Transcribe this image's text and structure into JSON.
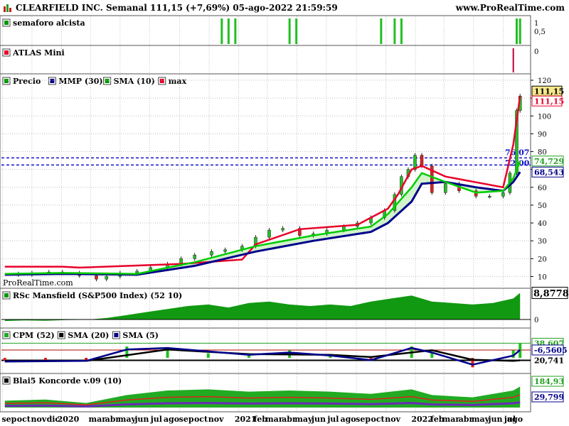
{
  "header": {
    "title": "CLEARFIELD INC. Semanal 111,15 (+7,69%) 05-ago-2022 21:59:59",
    "site": "www.ProRealTime.com"
  },
  "watermark": "ProRealTime.com",
  "colors": {
    "green": "#009900",
    "lightgreen": "#00cc00",
    "red": "#e8002a",
    "navy": "#00008b",
    "blue": "#1010cc",
    "grid": "#c0c0c0",
    "box": "#f6e88a"
  },
  "chart_data": [
    {
      "type": "bar",
      "name": "semaforo alcista",
      "title": "semaforo alcista",
      "ytick_labels": [
        "1",
        "0,5"
      ],
      "signal_dates": [
        "2020-11-27",
        "2020-12-11",
        "2020-12-25",
        "2021-04-16",
        "2021-04-30",
        "2021-10-22",
        "2021-11-19",
        "2021-12-03",
        "2022-07-29",
        "2022-08-05"
      ]
    },
    {
      "type": "bar",
      "name": "ATLAS Mini",
      "title": "ATLAS Mini",
      "ytick_labels": [
        "0"
      ],
      "signal_dates": [
        "2022-07-22"
      ]
    },
    {
      "type": "line",
      "title": "Precio",
      "legend": [
        "Precio",
        "MMP (30)",
        "SMA (10)",
        "max"
      ],
      "ylim": [
        5,
        122
      ],
      "ytick_labels": [
        "120",
        "110",
        "100",
        "90",
        "80",
        "70",
        "60",
        "50",
        "40",
        "30",
        "20",
        "10"
      ],
      "hlines": [
        76.5,
        72.5
      ],
      "annotations": [
        "76,07",
        "72,00"
      ],
      "last_values": {
        "price": "111,15",
        "max": "111,15",
        "sma10": "74,729",
        "mmp30": "68,543"
      },
      "x_labels": [
        "sep",
        "oct",
        "nov",
        "dic",
        "2020",
        "mar",
        "abr",
        "may",
        "jun",
        "jul",
        "ago",
        "sep",
        "oct",
        "nov",
        "2021",
        "feb",
        "mar",
        "abr",
        "may",
        "jun",
        "jul",
        "ago",
        "sep",
        "oct",
        "nov",
        "2022",
        "feb",
        "mar",
        "abr",
        "may",
        "jun",
        "jul",
        "ago"
      ],
      "series": [
        {
          "name": "Precio",
          "x": [
            "2019-09-06",
            "2019-10-04",
            "2019-11-01",
            "2019-12-06",
            "2020-01-03",
            "2020-02-07",
            "2020-03-13",
            "2020-04-03",
            "2020-05-01",
            "2020-06-05",
            "2020-07-03",
            "2020-08-07",
            "2020-09-04",
            "2020-10-02",
            "2020-11-06",
            "2020-12-04",
            "2021-01-08",
            "2021-02-05",
            "2021-03-05",
            "2021-04-02",
            "2021-05-07",
            "2021-06-04",
            "2021-07-02",
            "2021-08-06",
            "2021-09-03",
            "2021-10-01",
            "2021-10-29",
            "2021-11-19",
            "2021-12-03",
            "2021-12-17",
            "2021-12-31",
            "2022-01-14",
            "2022-02-04",
            "2022-03-04",
            "2022-04-01",
            "2022-05-06",
            "2022-06-03",
            "2022-07-01",
            "2022-07-15",
            "2022-07-29",
            "2022-08-05"
          ],
          "values": [
            11.5,
            11,
            12,
            12.5,
            12,
            10.5,
            8.5,
            10,
            12,
            13,
            15,
            17,
            20,
            22,
            24,
            25,
            27,
            32,
            36,
            37,
            33,
            34,
            36,
            38,
            40,
            43,
            47,
            56,
            66,
            70,
            78,
            72,
            57,
            62,
            58,
            55,
            55,
            57,
            68,
            103,
            111.15
          ]
        },
        {
          "name": "max",
          "x": [
            "2019-09-06",
            "2020-01-03",
            "2020-02-07",
            "2020-09-04",
            "2021-01-08",
            "2021-02-05",
            "2021-05-07",
            "2021-09-03",
            "2021-10-01",
            "2021-11-05",
            "2021-11-26",
            "2021-12-24",
            "2022-01-14",
            "2022-03-04",
            "2022-07-01",
            "2022-07-22",
            "2022-08-05"
          ],
          "values": [
            15.5,
            15.5,
            15,
            17,
            19.5,
            28,
            36.5,
            39,
            43,
            48,
            56,
            70,
            72,
            66,
            60,
            84,
            111.15
          ]
        },
        {
          "name": "SMA (10)",
          "x": [
            "2019-09-06",
            "2020-01-03",
            "2020-06-05",
            "2020-10-02",
            "2021-02-05",
            "2021-06-04",
            "2021-10-01",
            "2021-11-05",
            "2021-12-24",
            "2022-01-14",
            "2022-03-04",
            "2022-05-06",
            "2022-07-01",
            "2022-07-22",
            "2022-08-05"
          ],
          "values": [
            11.5,
            12,
            11.5,
            18,
            27,
            33,
            38,
            45,
            60,
            68,
            63,
            57,
            58,
            65,
            74.729
          ]
        },
        {
          "name": "MMP (30)",
          "x": [
            "2019-09-06",
            "2020-01-03",
            "2020-06-05",
            "2020-10-02",
            "2021-02-05",
            "2021-06-04",
            "2021-10-01",
            "2021-11-05",
            "2021-12-24",
            "2022-01-14",
            "2022-03-04",
            "2022-05-06",
            "2022-07-01",
            "2022-07-22",
            "2022-08-05"
          ],
          "values": [
            11,
            11.5,
            11,
            16,
            24,
            30,
            35,
            40,
            52,
            62,
            63,
            60,
            58,
            63,
            68.543
          ]
        }
      ]
    },
    {
      "type": "area",
      "title": "RSc Mansfield (S&P500 Index) (52 10)",
      "ytick_labels": [
        "0"
      ],
      "last_value": "8,8778",
      "series": [
        {
          "name": "RSc Mansfield (S&P500 Index) (52 10)",
          "x": [
            "2019-09-06",
            "2019-10-18",
            "2019-11-29",
            "2020-01-10",
            "2020-02-21",
            "2020-04-03",
            "2020-05-15",
            "2020-06-26",
            "2020-08-07",
            "2020-09-18",
            "2020-10-30",
            "2020-12-11",
            "2021-01-22",
            "2021-03-05",
            "2021-04-16",
            "2021-05-28",
            "2021-07-09",
            "2021-08-20",
            "2021-10-01",
            "2021-11-12",
            "2021-12-24",
            "2022-02-04",
            "2022-03-18",
            "2022-04-29",
            "2022-06-10",
            "2022-07-22",
            "2022-08-05"
          ],
          "values": [
            -0.5,
            -0.3,
            -0.4,
            -0.2,
            -0.1,
            0.5,
            1.5,
            2.5,
            3.5,
            4.5,
            5,
            4,
            5.5,
            6,
            5,
            4.5,
            5,
            4.5,
            6,
            7,
            8,
            6,
            5.5,
            5,
            5.5,
            7,
            8.8778
          ]
        }
      ]
    },
    {
      "type": "bar",
      "title": "CPM (52)",
      "legend": [
        "CPM (52)",
        "SMA (20)",
        "SMA (5)"
      ],
      "ytick_labels": [
        "38,607",
        "20,741",
        "-6,5605"
      ],
      "hlines": [
        "38,607",
        "20,741",
        "-6,5605"
      ],
      "last_values": {
        "cpm": "38,607",
        "sma20": "20,741",
        "sma5": "-6,5605"
      },
      "series": [
        {
          "name": "CPM (52)",
          "x": [
            "2019-09-06",
            "2019-11-29",
            "2020-02-21",
            "2020-05-15",
            "2020-08-07",
            "2020-10-30",
            "2021-01-22",
            "2021-04-16",
            "2021-07-09",
            "2021-10-01",
            "2021-12-24",
            "2022-02-04",
            "2022-04-29",
            "2022-07-22",
            "2022-08-05"
          ],
          "values": [
            -8,
            -10,
            -5,
            30,
            28,
            12,
            6,
            20,
            10,
            -5,
            30,
            15,
            -25,
            20,
            38.607
          ]
        },
        {
          "name": "SMA (20)",
          "x": [
            "2019-09-06",
            "2020-02-21",
            "2020-08-07",
            "2021-01-22",
            "2021-07-09",
            "2021-10-01",
            "2022-02-04",
            "2022-04-29",
            "2022-07-22",
            "2022-08-05"
          ],
          "values": [
            -8,
            -8,
            22,
            10,
            8,
            2,
            20,
            -5,
            -8,
            -6.5605
          ]
        },
        {
          "name": "SMA (5)",
          "x": [
            "2019-09-06",
            "2020-02-21",
            "2020-05-15",
            "2020-08-07",
            "2021-01-22",
            "2021-04-16",
            "2021-07-09",
            "2021-10-01",
            "2021-12-24",
            "2022-02-04",
            "2022-04-29",
            "2022-07-22",
            "2022-08-05"
          ],
          "values": [
            -10,
            -8,
            22,
            26,
            8,
            14,
            6,
            -6,
            26,
            14,
            -18,
            6,
            20.741
          ]
        }
      ]
    },
    {
      "type": "area",
      "title": "Blai5 Koncorde v.09 (10)",
      "ytick_labels": [
        "184,93",
        "29,799"
      ],
      "last_values": {
        "upper": "184,93",
        "lower": "29,799"
      },
      "series": [
        {
          "name": "Blai5 Koncorde v.09 (10)",
          "x": [
            "2019-09-06",
            "2019-11-29",
            "2020-02-21",
            "2020-05-15",
            "2020-08-07",
            "2020-10-30",
            "2021-01-22",
            "2021-04-16",
            "2021-07-09",
            "2021-10-01",
            "2021-12-24",
            "2022-02-04",
            "2022-04-29",
            "2022-07-22",
            "2022-08-05"
          ],
          "values": [
            60,
            70,
            40,
            110,
            150,
            160,
            140,
            150,
            140,
            120,
            160,
            110,
            90,
            150,
            184.93
          ]
        }
      ]
    }
  ]
}
